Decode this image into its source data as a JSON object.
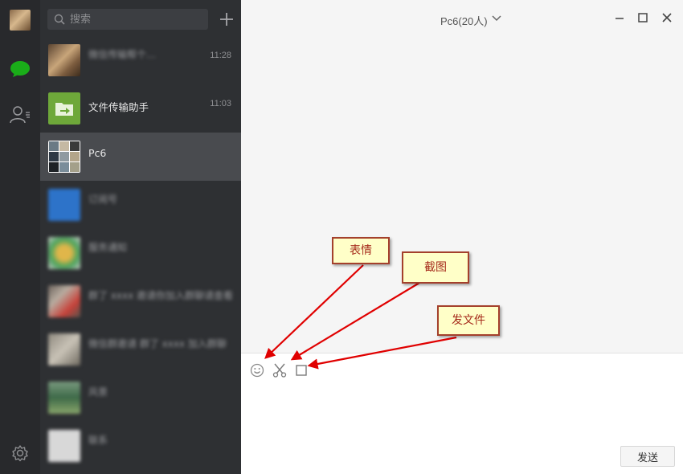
{
  "search": {
    "placeholder": "搜索"
  },
  "sessions": [
    {
      "name": "",
      "preview": "微信传输帮个…",
      "time": "11:28",
      "avatar_color": "#9a7a56"
    },
    {
      "name": "文件传输助手",
      "preview": "",
      "time": "11:03",
      "avatar_color": "#6ea83a"
    },
    {
      "name": "Pc6",
      "preview": "",
      "time": "",
      "avatar_color": "#7e7e7e"
    },
    {
      "name": "",
      "preview": "订阅号",
      "time": "",
      "avatar_color": "#2d73c9"
    },
    {
      "name": "",
      "preview": "服务通知",
      "time": "",
      "avatar_color": "#c9c9c9"
    },
    {
      "name": "",
      "preview": "群了 xxxx 邀请你加入群聊请查看",
      "time": "",
      "avatar_color": "#8a7f76"
    },
    {
      "name": "",
      "preview": "微信群邀请 群了 xxxx 加入群聊",
      "time": "",
      "avatar_color": "#9e9a8f"
    },
    {
      "name": "",
      "preview": "风景",
      "time": "",
      "avatar_color": "#5d8a62"
    },
    {
      "name": "",
      "preview": "联系",
      "time": "",
      "avatar_color": "#d8d8d8"
    }
  ],
  "chat": {
    "title": "Pc6(20人)"
  },
  "input": {
    "send_label": "发送"
  },
  "callouts": {
    "emoji": "表情",
    "screenshot": "截图",
    "file": "发文件"
  },
  "colors": {
    "nav_bg": "#28292c",
    "list_bg": "#2e3033",
    "active_bg": "#494b4f",
    "callout_bg": "#ffffc8",
    "arrow": "#e00000"
  },
  "icons": [
    "wechat-chat-icon",
    "contacts-icon",
    "settings-icon",
    "search-icon",
    "plus-icon",
    "chevron-down-icon",
    "minimize-icon",
    "maximize-icon",
    "close-icon",
    "emoji-icon",
    "scissors-icon",
    "file-icon"
  ]
}
